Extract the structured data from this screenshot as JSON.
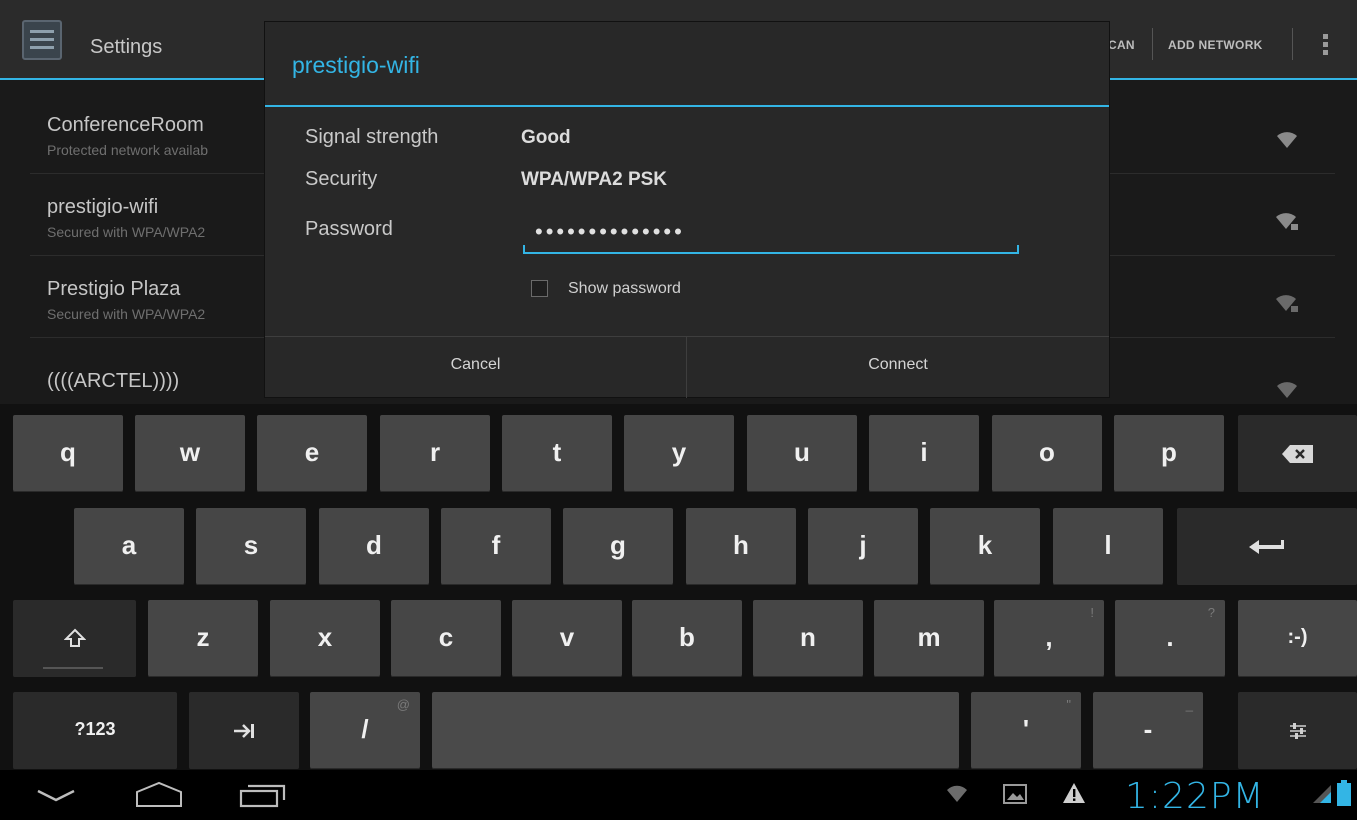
{
  "actionbar": {
    "title": "Settings",
    "scan_label": "CAN",
    "add_network_label": "ADD NETWORK"
  },
  "networks": [
    {
      "name": "ConferenceRoom",
      "status": "Protected network availab"
    },
    {
      "name": "prestigio-wifi",
      "status": "Secured with WPA/WPA2"
    },
    {
      "name": "Prestigio Plaza",
      "status": "Secured with WPA/WPA2"
    },
    {
      "name": "((((ARCTEL))))",
      "status": ""
    }
  ],
  "dialog": {
    "title": "prestigio-wifi",
    "signal_label": "Signal strength",
    "signal_value": "Good",
    "security_label": "Security",
    "security_value": "WPA/WPA2 PSK",
    "password_label": "Password",
    "password_value": "••••••••••••••",
    "show_password_label": "Show password",
    "show_password_checked": false,
    "cancel_label": "Cancel",
    "connect_label": "Connect"
  },
  "keyboard": {
    "row1": [
      "q",
      "w",
      "e",
      "r",
      "t",
      "y",
      "u",
      "i",
      "o",
      "p"
    ],
    "row2": [
      "a",
      "s",
      "d",
      "f",
      "g",
      "h",
      "j",
      "k",
      "l"
    ],
    "row3": [
      "z",
      "x",
      "c",
      "v",
      "b",
      "n",
      "m",
      ",",
      "."
    ],
    "row3_hints": {
      ",": "!",
      ".": "?"
    },
    "smiley_label": ":-)",
    "symbols_label": "?123",
    "slash_label": "/",
    "slash_hint": "@",
    "apostrophe_label": "'",
    "apostrophe_hint": "\"",
    "dash_label": "-",
    "dash_hint": "_"
  },
  "statusbar": {
    "time": "1:22PM"
  },
  "colors": {
    "accent": "#33b5e5",
    "key": "#464646",
    "key_dark": "#2a2a2a",
    "background": "#1a1a1a"
  }
}
